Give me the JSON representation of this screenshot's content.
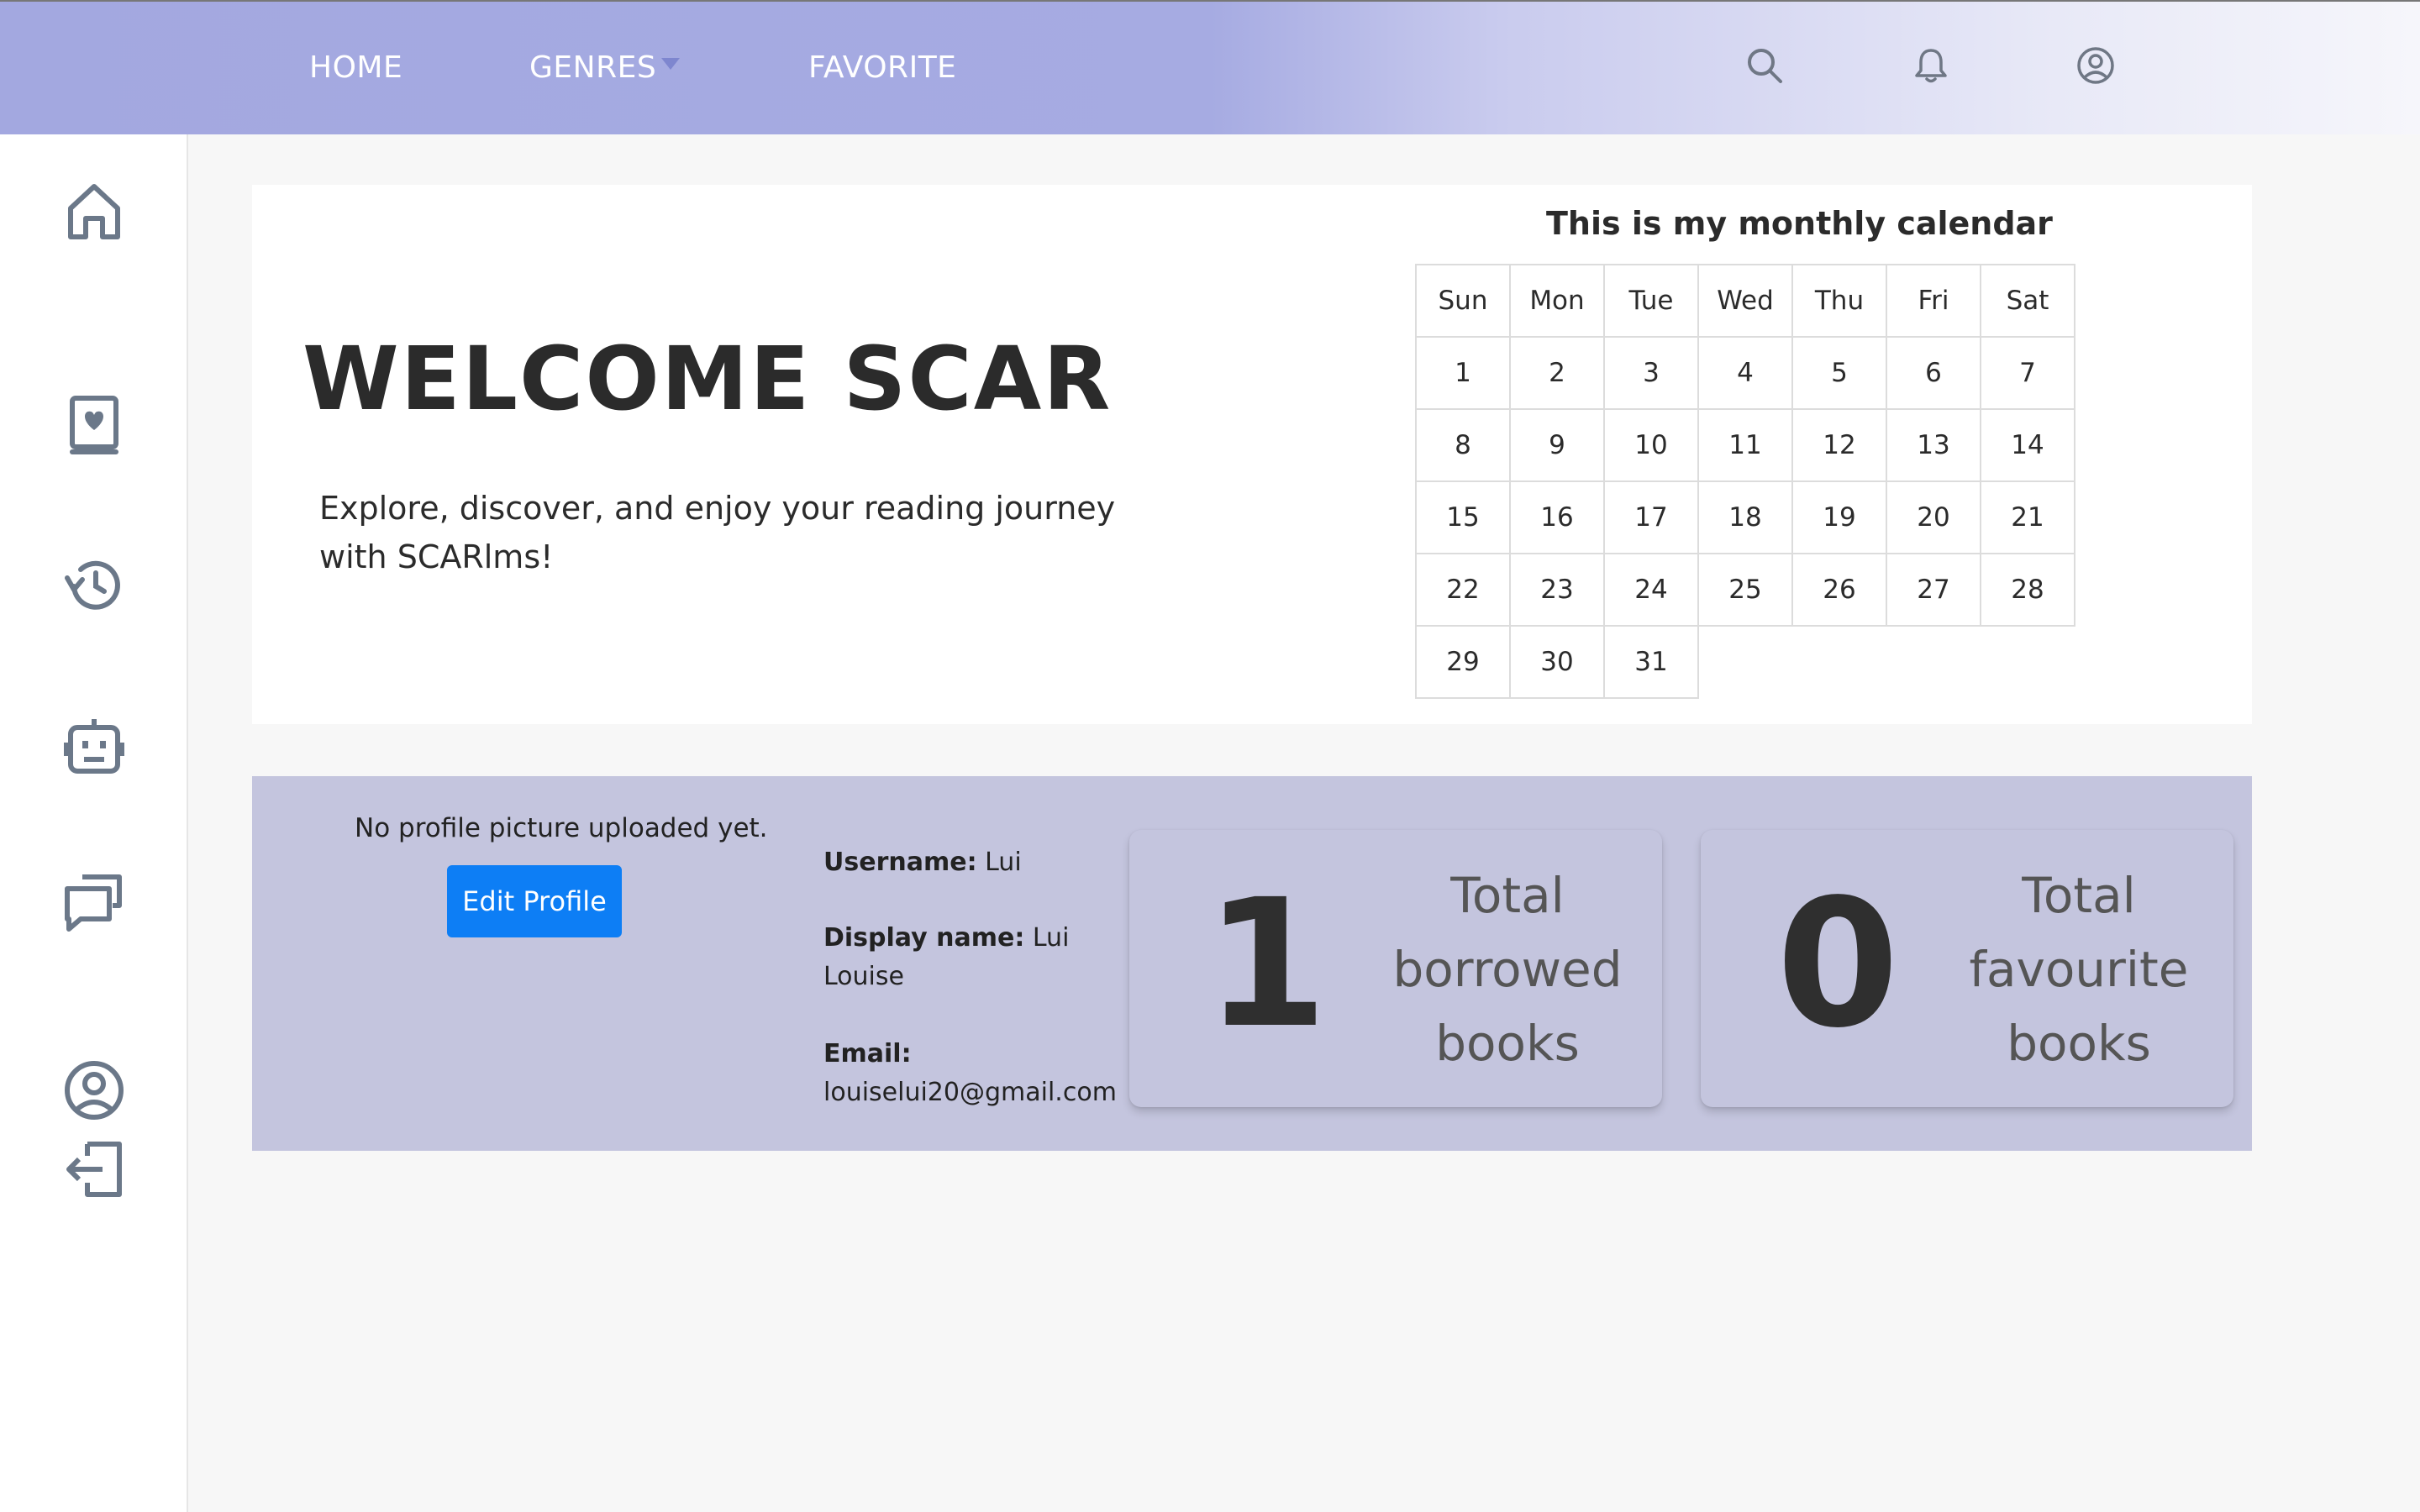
{
  "nav": {
    "home": "HOME",
    "genres": "GENRES",
    "favorite": "FAVORITE"
  },
  "icons": {
    "top": [
      "search-icon",
      "bell-icon",
      "user-circle-icon"
    ],
    "sidebar": [
      "home-icon",
      "book-heart-icon",
      "history-icon",
      "robot-icon",
      "chat-icon",
      "user-circle-icon",
      "logout-icon"
    ]
  },
  "colors": {
    "nav_gradient_start": "#a3a8e0",
    "accent_button": "#0d7ef5",
    "profile_band": "#c4c5de"
  },
  "welcome": {
    "title": "WELCOME SCAR",
    "subtitle": "Explore, discover, and enjoy your reading journey with SCARlms!"
  },
  "calendar": {
    "title": "This is my monthly calendar",
    "days": [
      "Sun",
      "Mon",
      "Tue",
      "Wed",
      "Thu",
      "Fri",
      "Sat"
    ],
    "weeks": [
      [
        "1",
        "2",
        "3",
        "4",
        "5",
        "6",
        "7"
      ],
      [
        "8",
        "9",
        "10",
        "11",
        "12",
        "13",
        "14"
      ],
      [
        "15",
        "16",
        "17",
        "18",
        "19",
        "20",
        "21"
      ],
      [
        "22",
        "23",
        "24",
        "25",
        "26",
        "27",
        "28"
      ],
      [
        "29",
        "30",
        "31",
        "",
        "",
        "",
        ""
      ]
    ]
  },
  "profile": {
    "no_picture": "No profile picture uploaded yet.",
    "edit_button": "Edit Profile",
    "username_label": "Username:",
    "username": "Lui",
    "display_label": "Display name:",
    "display_name": "Lui Louise",
    "email_label": "Email:",
    "email": "louiselui20@gmail.com"
  },
  "stats": {
    "borrowed_count": "1",
    "borrowed_label": "Total borrowed books",
    "favourite_count": "0",
    "favourite_label": "Total favourite books"
  }
}
